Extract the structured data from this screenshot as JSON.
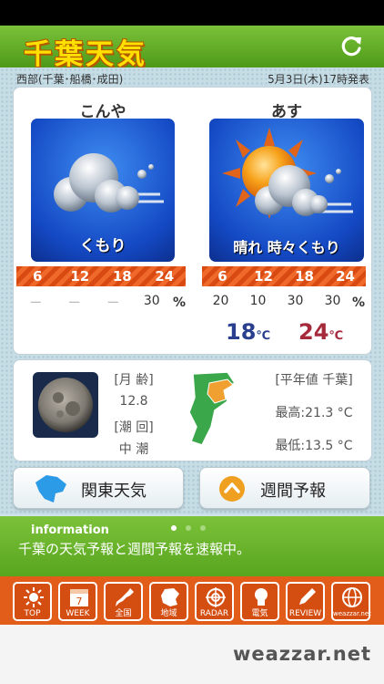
{
  "header": {
    "title": "千葉天気"
  },
  "subheader": {
    "region": "西部(千葉･船橋･成田)",
    "issued": "5月3日(木)17時発表"
  },
  "tonight": {
    "label": "こんや",
    "weather": "くもり",
    "times": [
      "6",
      "12",
      "18",
      "24"
    ],
    "rain": [
      "ー",
      "ー",
      "ー",
      "30"
    ],
    "pct": "%"
  },
  "tomorrow": {
    "label": "あす",
    "weather": "晴れ 時々くもり",
    "times": [
      "6",
      "12",
      "18",
      "24"
    ],
    "rain": [
      "20",
      "10",
      "30",
      "30"
    ],
    "pct": "%",
    "low": "18",
    "high": "24",
    "unit": "℃"
  },
  "moon": {
    "age_label": "[月 齢]",
    "age": "12.8",
    "tide_label": "[潮 回]",
    "tide": "中 潮"
  },
  "normals": {
    "label": "[平年値 千葉]",
    "high": "最高:21.3 °C",
    "low": "最低:13.5 °C"
  },
  "buttons": {
    "kanto": "関東天気",
    "weekly": "週間予報"
  },
  "info": {
    "heading": "information",
    "message": "千葉の天気予報と週間予報を速報中。"
  },
  "tabs": [
    {
      "label": "TOP",
      "icon": "sun-icon"
    },
    {
      "label": "WEEK",
      "icon": "calendar-icon"
    },
    {
      "label": "全国",
      "icon": "japan-map-icon"
    },
    {
      "label": "地域",
      "icon": "region-map-icon"
    },
    {
      "label": "RADAR",
      "icon": "radar-icon"
    },
    {
      "label": "電気",
      "icon": "lightbulb-icon"
    },
    {
      "label": "REVIEW",
      "icon": "pencil-icon"
    },
    {
      "label": "weazzar.net",
      "icon": "globe-icon"
    }
  ],
  "calendar_day": "7",
  "footer": {
    "brand": "weazzar.net"
  },
  "colors": {
    "header_green": "#5aa61f",
    "title_yellow": "#ffe000",
    "tab_orange": "#e25d1a",
    "low_temp": "#2b3f8f",
    "high_temp": "#a52a3c"
  }
}
